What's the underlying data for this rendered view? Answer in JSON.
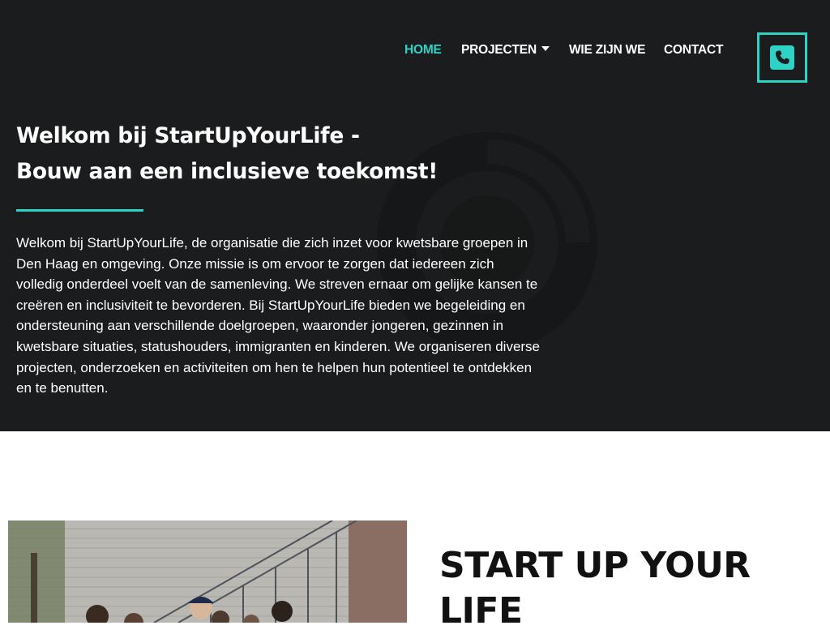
{
  "nav": {
    "items": [
      {
        "label": "HOME",
        "active": true
      },
      {
        "label": "PROJECTEN",
        "has_dropdown": true
      },
      {
        "label": "WIE ZIJN WE"
      },
      {
        "label": "CONTACT"
      }
    ],
    "phone_icon": "phone-icon"
  },
  "hero": {
    "title_line1": "Welkom bij StartUpYourLife -",
    "title_line2": "Bouw aan een inclusieve toekomst!",
    "intro": "Welkom bij StartUpYourLife, de organisatie die zich inzet voor kwetsbare groepen in Den Haag en omgeving. Onze missie is om ervoor te zorgen dat iedereen zich volledig onderdeel voelt van de samenleving. We streven ernaar om gelijke kansen te creëren en inclusiviteit te bevorderen. Bij StartUpYourLife bieden we begeleiding en ondersteuning aan verschillende doelgroepen, waaronder jongeren, gezinnen in kwetsbare situaties, statushouders, immigranten en kinderen. We organiseren diverse projecten, onderzoeken en activiteiten om hen te helpen hun potentieel te ontdekken en te benutten."
  },
  "section2": {
    "title_line1": "START UP YOUR",
    "title_line2": "LIFE",
    "photo": "group-photo"
  },
  "colors": {
    "accent": "#2ed3c6",
    "hero_bg": "#1b1c1d",
    "text_light": "#ffffff",
    "text_dark": "#111111"
  }
}
